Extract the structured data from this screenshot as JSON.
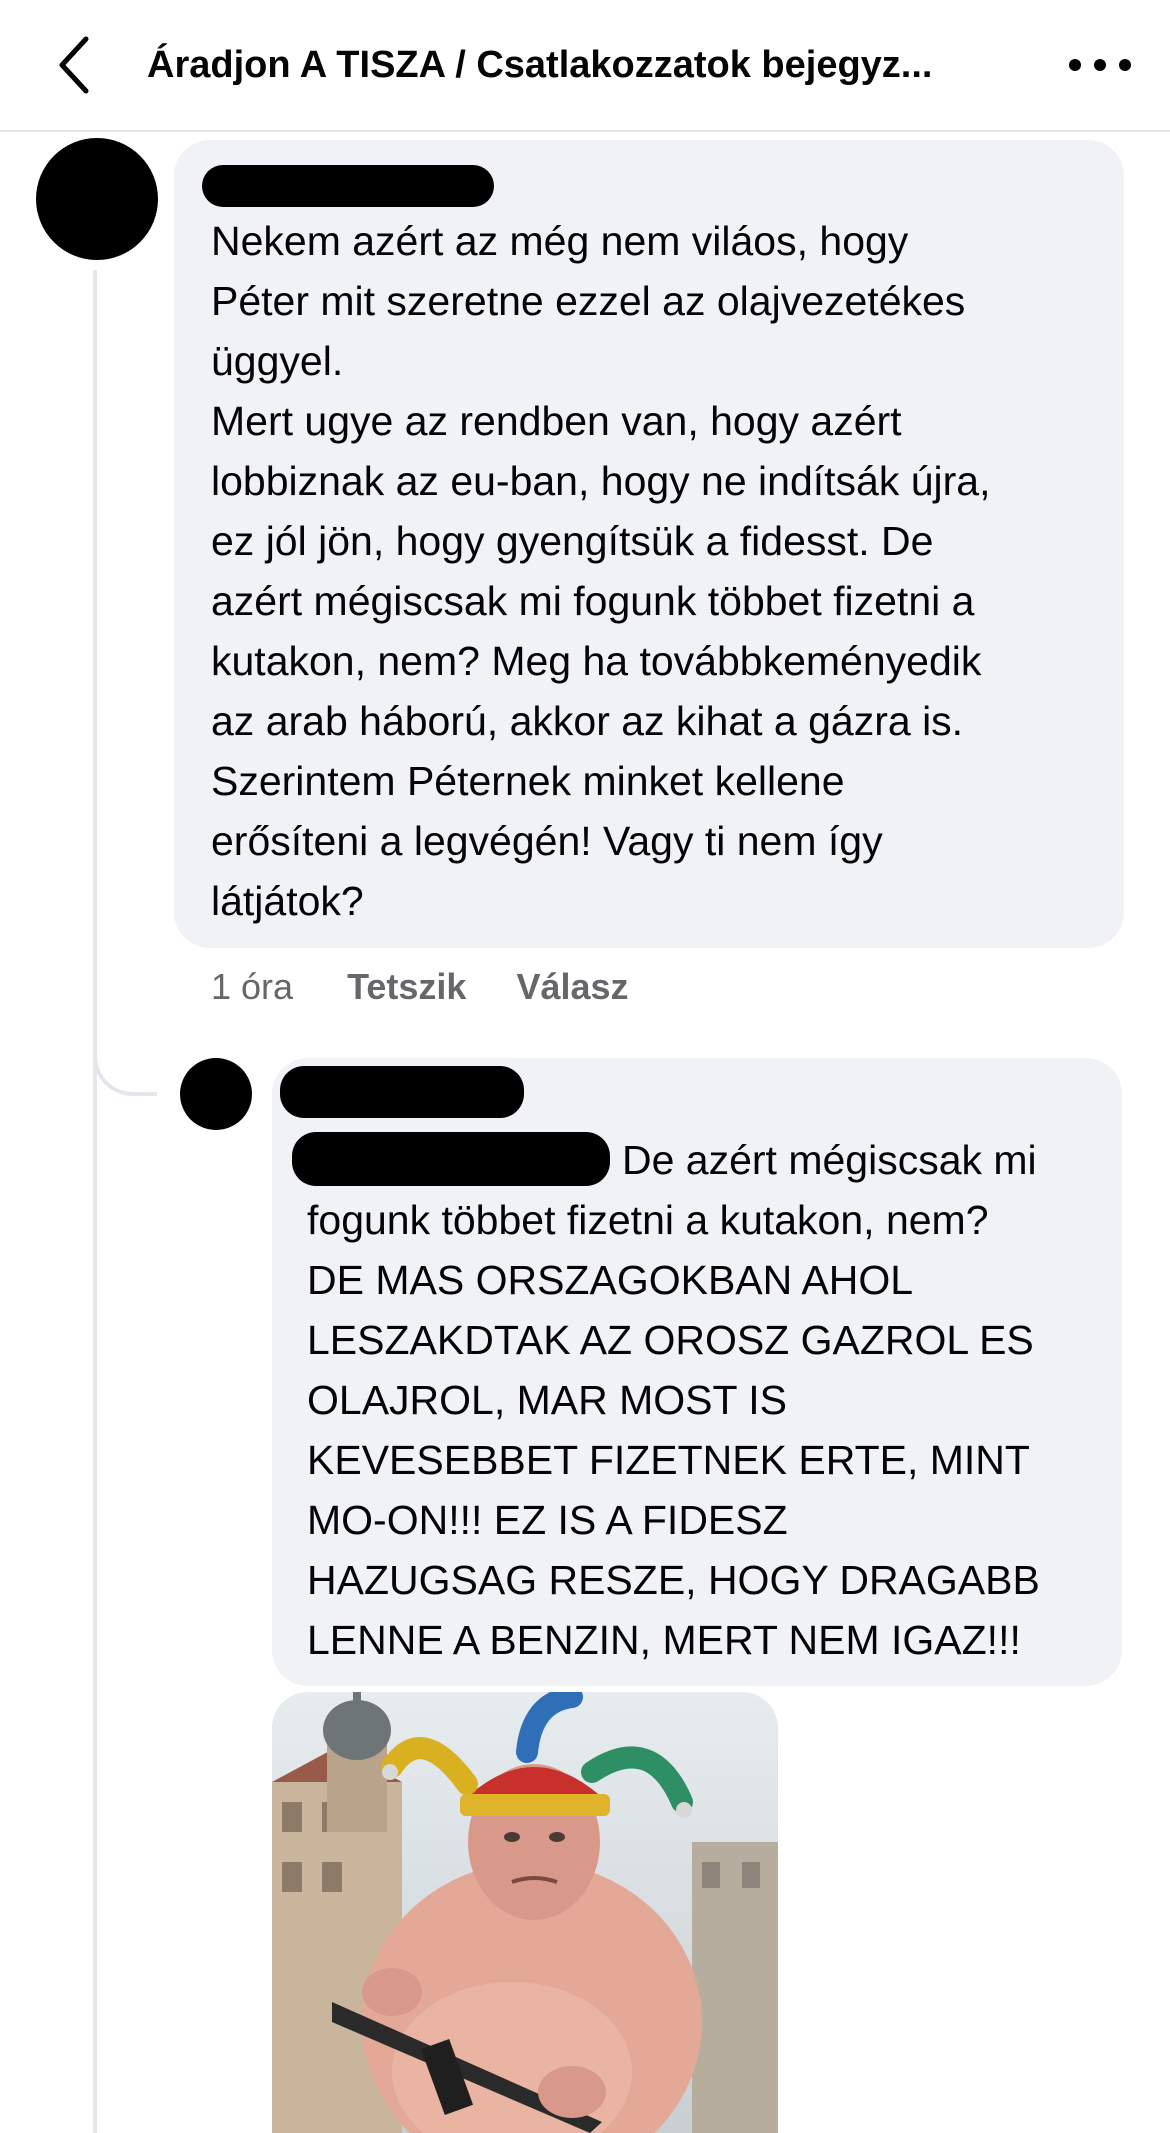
{
  "header": {
    "title": "Áradjon A TISZA / Csatlakozzatok  bejegyz...",
    "back_icon": "chevron-left-icon",
    "more_icon": "ellipsis-horizontal-icon"
  },
  "comments": [
    {
      "author": "",
      "text": "Nekem azért az még nem viláos, hogy\nPéter mit szeretne ezzel az olajvezetékes\nüggyel.\nMert ugye az rendben van, hogy azért\nlobbiznak az eu-ban, hogy ne indítsák újra,\nez jól jön, hogy gyengítsük a fidesst. De\nazért mégiscsak mi fogunk többet fizetni a\nkutakon, nem? Meg ha továbbkeményedik\naz arab háború, akkor az kihat a gázra is.\nSzerintem Péternek minket kellene\nerősíteni a legvégén! Vagy ti nem így\nlátjátok?",
      "time": "1 óra",
      "like_label": "Tetszik",
      "reply_label": "Válasz"
    },
    {
      "author": "",
      "mention_tail": "De azért mégiscsak mi",
      "text": "fogunk többet fizetni a kutakon, nem?\nDE MAS ORSZAGOKBAN AHOL\nLESZAKDTAK AZ OROSZ GAZROL ES\nOLAJROL, MAR MOST IS\nKEVESEBBET FIZETNEK ERTE, MINT\nMO-ON!!!   EZ IS A FIDESZ\nHAZUGSAG RESZE, HOGY DRAGABB\nLENNE A BENZIN, MERT NEM IGAZ!!!"
    }
  ],
  "colors": {
    "bubble": "#f0f2f5",
    "meta_text": "#65676b",
    "divider": "#e4e6eb"
  }
}
